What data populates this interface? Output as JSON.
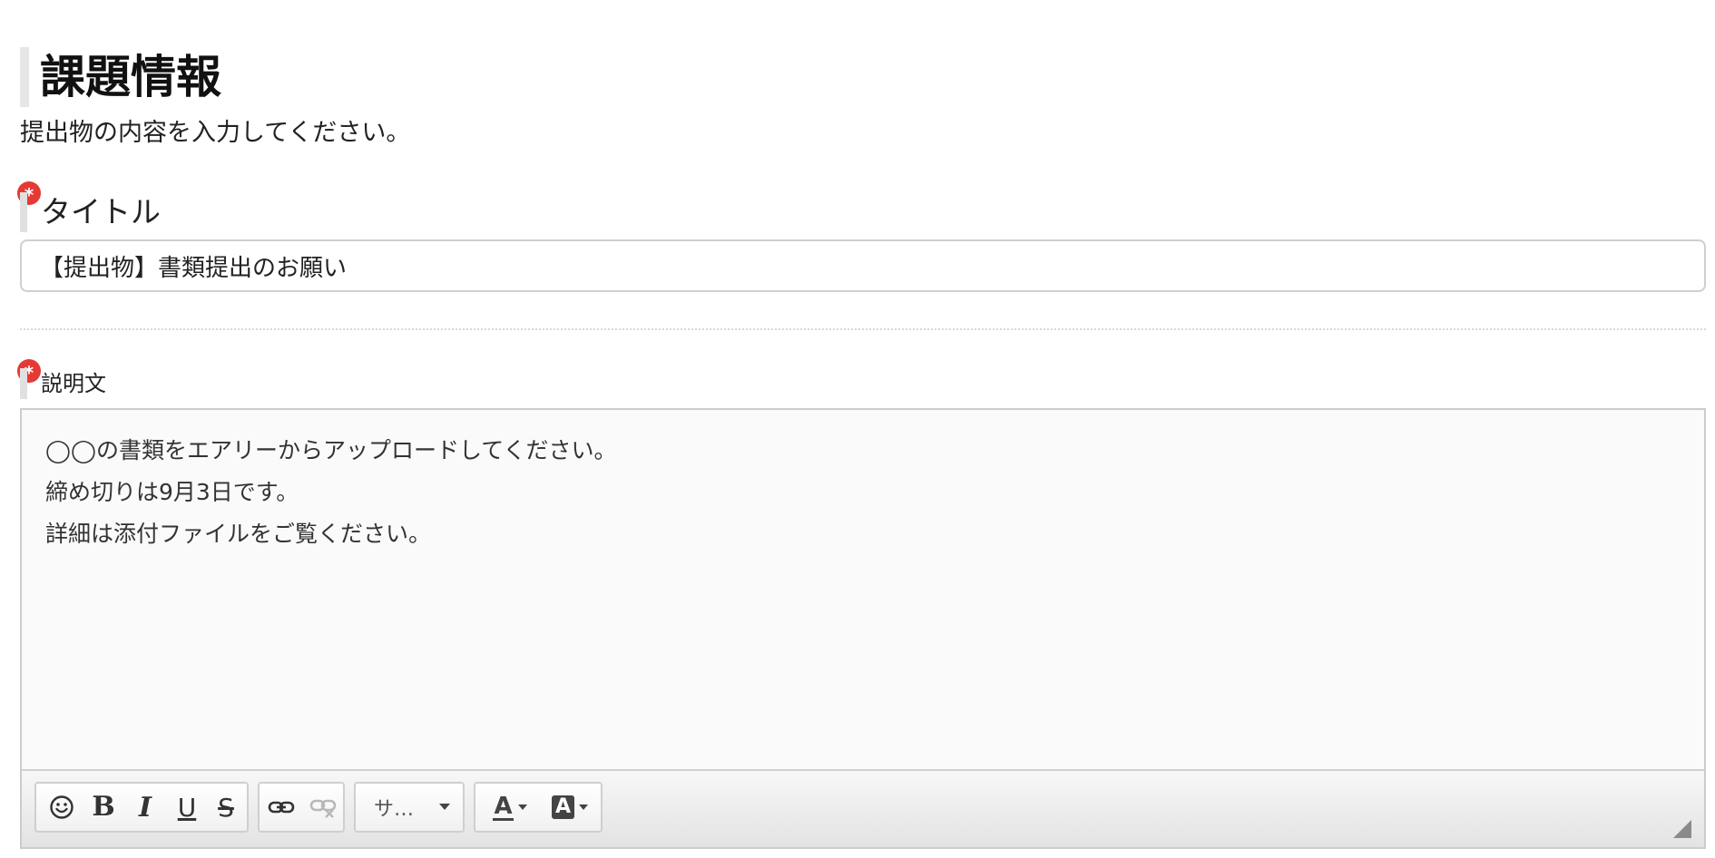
{
  "page": {
    "heading": "課題情報",
    "instruction": "提出物の内容を入力してください。"
  },
  "title_field": {
    "required_mark": "*",
    "label": "タイトル",
    "value": "【提出物】書類提出のお願い"
  },
  "description_field": {
    "required_mark": "*",
    "label": "説明文",
    "lines": [
      "◯◯の書類をエアリーからアップロードしてください。",
      "締め切りは9月3日です。",
      "詳細は添付ファイルをご覧ください。"
    ]
  },
  "toolbar": {
    "emoji_icon": "smiley-icon",
    "bold_label": "B",
    "italic_label": "I",
    "underline_label": "U",
    "strike_label": "S",
    "link_icon": "link-icon",
    "unlink_icon": "unlink-icon",
    "font_select_value": "サ…",
    "text_color_label": "A",
    "bg_color_label": "A"
  },
  "colors": {
    "required": "#e53935",
    "heading_bar": "#e6e6e6",
    "editor_bg": "#fafafa"
  }
}
